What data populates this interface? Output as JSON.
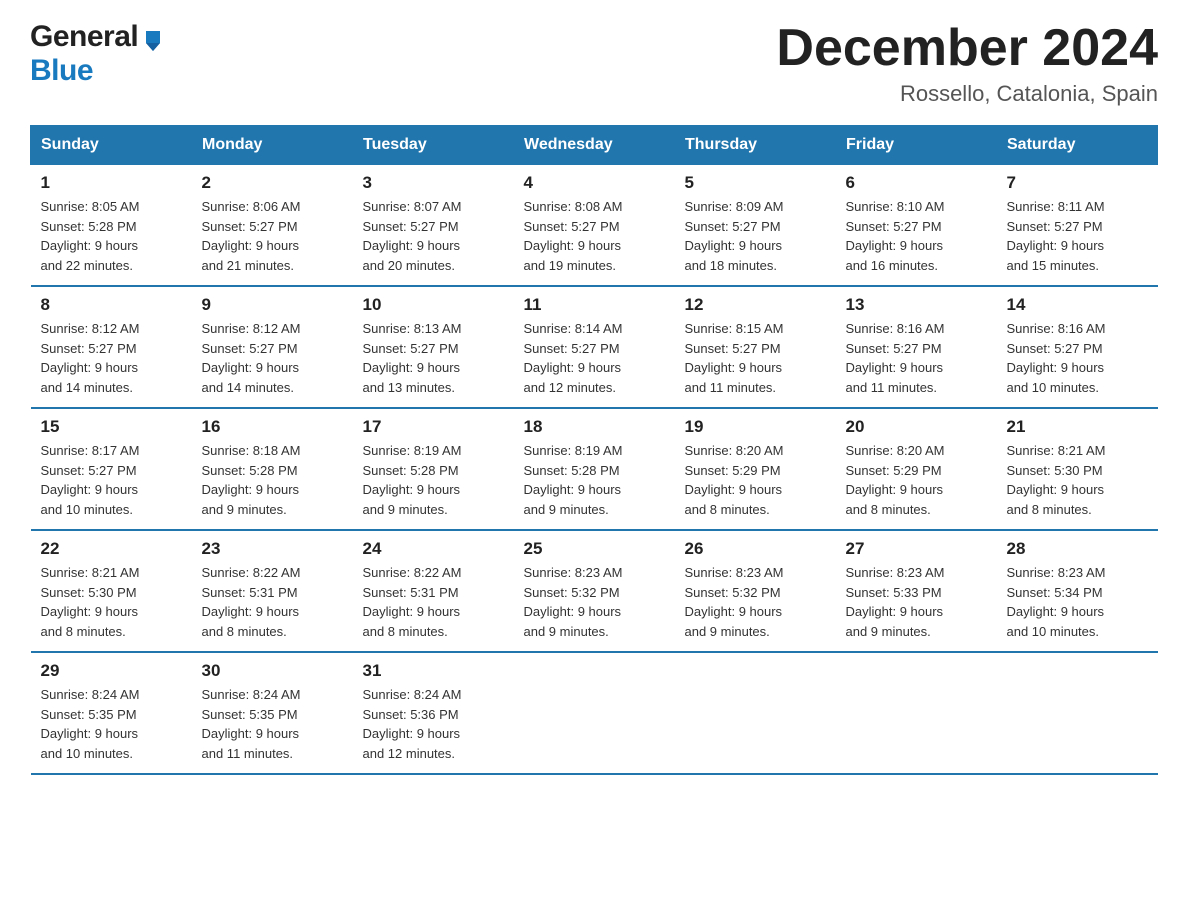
{
  "header": {
    "logo_general": "General",
    "logo_blue": "Blue",
    "month_title": "December 2024",
    "location": "Rossello, Catalonia, Spain"
  },
  "days_of_week": [
    "Sunday",
    "Monday",
    "Tuesday",
    "Wednesday",
    "Thursday",
    "Friday",
    "Saturday"
  ],
  "weeks": [
    [
      {
        "day": "1",
        "sunrise": "8:05 AM",
        "sunset": "5:28 PM",
        "daylight": "9 hours and 22 minutes."
      },
      {
        "day": "2",
        "sunrise": "8:06 AM",
        "sunset": "5:27 PM",
        "daylight": "9 hours and 21 minutes."
      },
      {
        "day": "3",
        "sunrise": "8:07 AM",
        "sunset": "5:27 PM",
        "daylight": "9 hours and 20 minutes."
      },
      {
        "day": "4",
        "sunrise": "8:08 AM",
        "sunset": "5:27 PM",
        "daylight": "9 hours and 19 minutes."
      },
      {
        "day": "5",
        "sunrise": "8:09 AM",
        "sunset": "5:27 PM",
        "daylight": "9 hours and 18 minutes."
      },
      {
        "day": "6",
        "sunrise": "8:10 AM",
        "sunset": "5:27 PM",
        "daylight": "9 hours and 16 minutes."
      },
      {
        "day": "7",
        "sunrise": "8:11 AM",
        "sunset": "5:27 PM",
        "daylight": "9 hours and 15 minutes."
      }
    ],
    [
      {
        "day": "8",
        "sunrise": "8:12 AM",
        "sunset": "5:27 PM",
        "daylight": "9 hours and 14 minutes."
      },
      {
        "day": "9",
        "sunrise": "8:12 AM",
        "sunset": "5:27 PM",
        "daylight": "9 hours and 14 minutes."
      },
      {
        "day": "10",
        "sunrise": "8:13 AM",
        "sunset": "5:27 PM",
        "daylight": "9 hours and 13 minutes."
      },
      {
        "day": "11",
        "sunrise": "8:14 AM",
        "sunset": "5:27 PM",
        "daylight": "9 hours and 12 minutes."
      },
      {
        "day": "12",
        "sunrise": "8:15 AM",
        "sunset": "5:27 PM",
        "daylight": "9 hours and 11 minutes."
      },
      {
        "day": "13",
        "sunrise": "8:16 AM",
        "sunset": "5:27 PM",
        "daylight": "9 hours and 11 minutes."
      },
      {
        "day": "14",
        "sunrise": "8:16 AM",
        "sunset": "5:27 PM",
        "daylight": "9 hours and 10 minutes."
      }
    ],
    [
      {
        "day": "15",
        "sunrise": "8:17 AM",
        "sunset": "5:27 PM",
        "daylight": "9 hours and 10 minutes."
      },
      {
        "day": "16",
        "sunrise": "8:18 AM",
        "sunset": "5:28 PM",
        "daylight": "9 hours and 9 minutes."
      },
      {
        "day": "17",
        "sunrise": "8:19 AM",
        "sunset": "5:28 PM",
        "daylight": "9 hours and 9 minutes."
      },
      {
        "day": "18",
        "sunrise": "8:19 AM",
        "sunset": "5:28 PM",
        "daylight": "9 hours and 9 minutes."
      },
      {
        "day": "19",
        "sunrise": "8:20 AM",
        "sunset": "5:29 PM",
        "daylight": "9 hours and 8 minutes."
      },
      {
        "day": "20",
        "sunrise": "8:20 AM",
        "sunset": "5:29 PM",
        "daylight": "9 hours and 8 minutes."
      },
      {
        "day": "21",
        "sunrise": "8:21 AM",
        "sunset": "5:30 PM",
        "daylight": "9 hours and 8 minutes."
      }
    ],
    [
      {
        "day": "22",
        "sunrise": "8:21 AM",
        "sunset": "5:30 PM",
        "daylight": "9 hours and 8 minutes."
      },
      {
        "day": "23",
        "sunrise": "8:22 AM",
        "sunset": "5:31 PM",
        "daylight": "9 hours and 8 minutes."
      },
      {
        "day": "24",
        "sunrise": "8:22 AM",
        "sunset": "5:31 PM",
        "daylight": "9 hours and 8 minutes."
      },
      {
        "day": "25",
        "sunrise": "8:23 AM",
        "sunset": "5:32 PM",
        "daylight": "9 hours and 9 minutes."
      },
      {
        "day": "26",
        "sunrise": "8:23 AM",
        "sunset": "5:32 PM",
        "daylight": "9 hours and 9 minutes."
      },
      {
        "day": "27",
        "sunrise": "8:23 AM",
        "sunset": "5:33 PM",
        "daylight": "9 hours and 9 minutes."
      },
      {
        "day": "28",
        "sunrise": "8:23 AM",
        "sunset": "5:34 PM",
        "daylight": "9 hours and 10 minutes."
      }
    ],
    [
      {
        "day": "29",
        "sunrise": "8:24 AM",
        "sunset": "5:35 PM",
        "daylight": "9 hours and 10 minutes."
      },
      {
        "day": "30",
        "sunrise": "8:24 AM",
        "sunset": "5:35 PM",
        "daylight": "9 hours and 11 minutes."
      },
      {
        "day": "31",
        "sunrise": "8:24 AM",
        "sunset": "5:36 PM",
        "daylight": "9 hours and 12 minutes."
      },
      null,
      null,
      null,
      null
    ]
  ],
  "labels": {
    "sunrise": "Sunrise:",
    "sunset": "Sunset:",
    "daylight": "Daylight:"
  }
}
